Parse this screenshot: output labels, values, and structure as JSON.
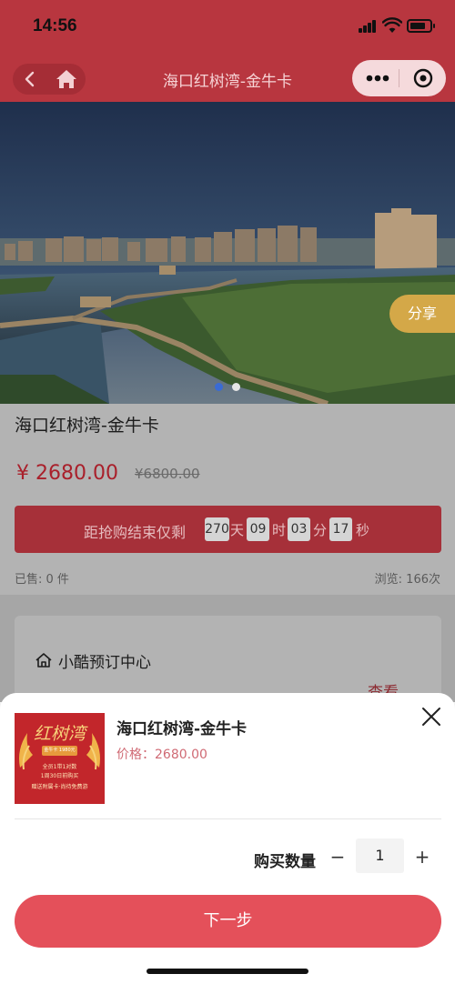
{
  "status_bar": {
    "time": "14:56"
  },
  "nav": {
    "title": "海口红树湾-金牛卡"
  },
  "hero": {
    "share_label": "分享"
  },
  "product": {
    "title": "海口红树湾-金牛卡",
    "price": "¥ 2680.00",
    "original_price": "¥6800.00",
    "countdown": {
      "prefix": "距抢购结束仅剩",
      "days": "270",
      "days_unit": "天",
      "hours": "09",
      "hours_unit": "时",
      "minutes": "03",
      "minutes_unit": "分",
      "seconds": "17",
      "seconds_unit": "秒"
    },
    "sold": "已售: 0 件",
    "views": "浏览: 166次"
  },
  "store": {
    "name": "小酷预订中心",
    "view_label": "查看"
  },
  "sheet": {
    "title": "海口红树湾-金牛卡",
    "price": "价格：2680.00",
    "thumb_brand": "红树湾",
    "thumb_tag": "金牛卡 1980元",
    "thumb_lines": [
      "全员1带1对数",
      "1周30日前购买",
      "赠送附属卡·尚待免费游"
    ],
    "quantity_label": "购买数量",
    "minus": "−",
    "quantity": "1",
    "plus": "+",
    "next_label": "下一步"
  },
  "colors": {
    "brand_red": "#b8363f",
    "button_red": "#e4505a",
    "share_gold": "#d4a848"
  }
}
